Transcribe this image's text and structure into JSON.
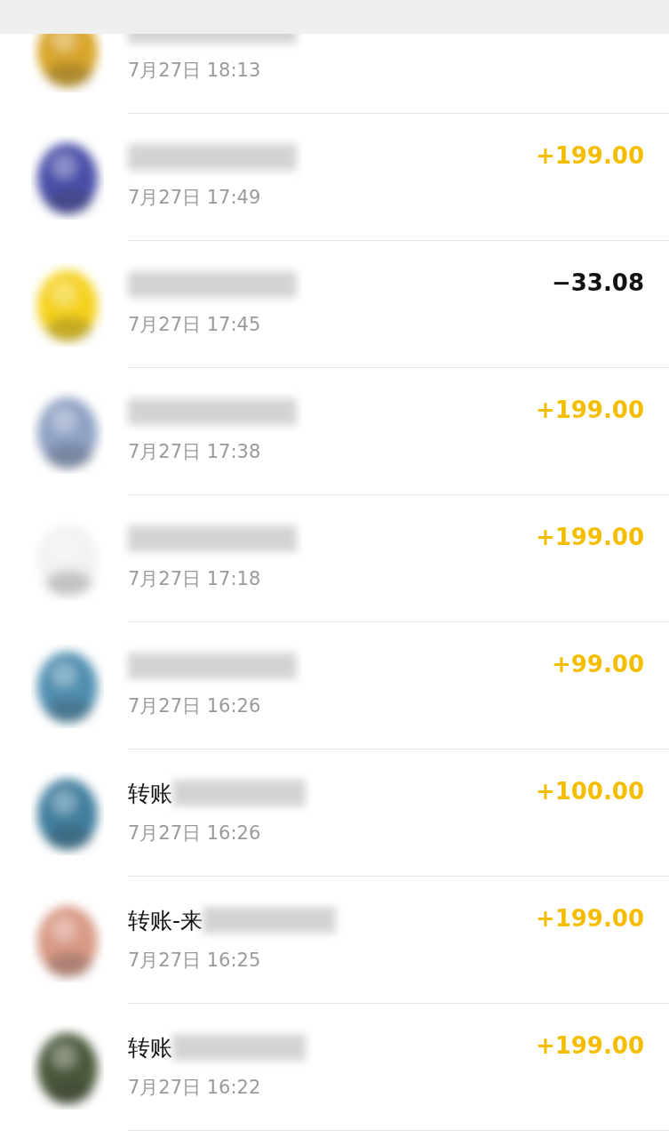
{
  "rows": [
    {
      "time": "7月27日 18:13"
    },
    {
      "time": "7月27日 17:49",
      "amount": "+199.00",
      "kind": "income"
    },
    {
      "time": "7月27日 17:45",
      "amount": "−33.08",
      "kind": "expense"
    },
    {
      "time": "7月27日 17:38",
      "amount": "+199.00",
      "kind": "income"
    },
    {
      "time": "7月27日 17:18",
      "amount": "+199.00",
      "kind": "income"
    },
    {
      "time": "7月27日 16:26",
      "amount": "+99.00",
      "kind": "income"
    },
    {
      "title": "转账",
      "time": "7月27日 16:26",
      "amount": "+100.00",
      "kind": "income"
    },
    {
      "title": "转账-来",
      "time": "7月27日 16:25",
      "amount": "+199.00",
      "kind": "income"
    },
    {
      "title": "转账",
      "time": "7月27日 16:22",
      "amount": "+199.00",
      "kind": "income"
    }
  ]
}
